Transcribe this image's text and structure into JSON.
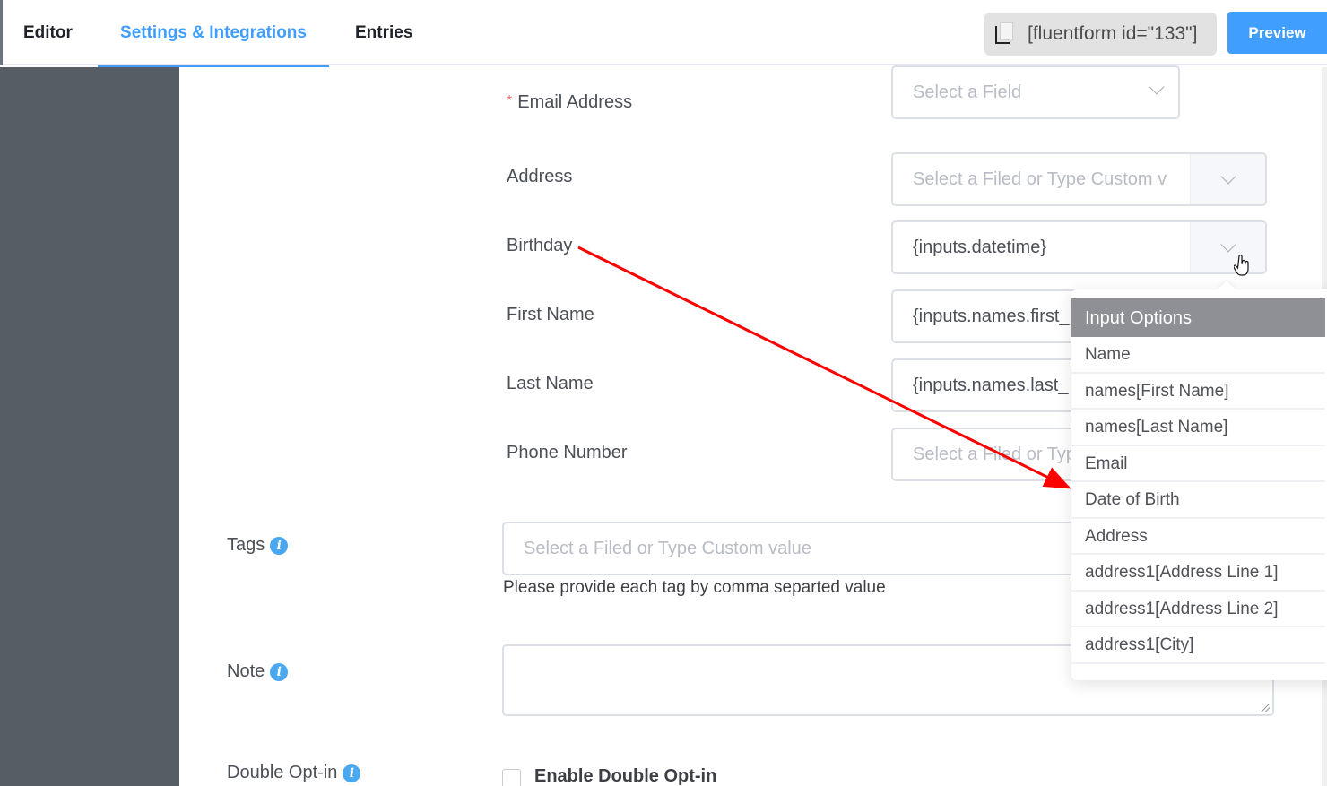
{
  "header": {
    "tabs": [
      {
        "label": "Editor",
        "active": false
      },
      {
        "label": "Settings & Integrations",
        "active": true
      },
      {
        "label": "Entries",
        "active": false
      }
    ],
    "shortcode": "[fluentform id=\"133\"]",
    "shortcode_icon": "copy-icon",
    "preview_label": "Preview",
    "accent_color": "#409eff"
  },
  "mapping": {
    "email": {
      "label": "Email Address",
      "required": true,
      "required_mark": "*",
      "placeholder": "Select a Field"
    },
    "rows": [
      {
        "label": "Address",
        "value": "",
        "placeholder": "Select a Filed or Type Custom v"
      },
      {
        "label": "Birthday",
        "value": "{inputs.datetime}",
        "placeholder": ""
      },
      {
        "label": "First Name",
        "value": "{inputs.names.first_",
        "placeholder": ""
      },
      {
        "label": "Last Name",
        "value": "{inputs.names.last_",
        "placeholder": ""
      },
      {
        "label": "Phone Number",
        "value": "",
        "placeholder": "Select a Filed or Typ"
      }
    ]
  },
  "tags": {
    "label": "Tags",
    "placeholder": "Select a Filed or Type Custom value",
    "help": "Please provide each tag by comma separted value"
  },
  "note": {
    "label": "Note",
    "value": ""
  },
  "double_optin": {
    "label": "Double Opt-in",
    "checkbox_label": "Enable Double Opt-in",
    "checked": false
  },
  "dropdown": {
    "title": "Input Options",
    "items": [
      "Name",
      "names[First Name]",
      "names[Last Name]",
      "Email",
      "Date of Birth",
      "Address",
      "address1[Address Line 1]",
      "address1[Address Line 2]",
      "address1[City]"
    ]
  },
  "annotation": {
    "type": "arrow",
    "color": "#ff0000",
    "from": "Birthday label",
    "to": "Date of Birth option"
  }
}
